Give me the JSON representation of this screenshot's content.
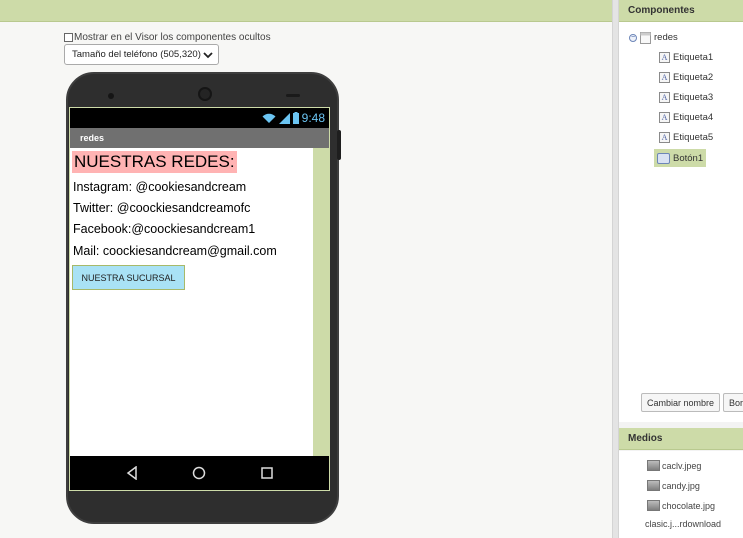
{
  "viewer": {
    "show_hidden_label": "Mostrar en el Visor los componentes ocultos",
    "size_select_value": "Tamaño del teléfono (505,320)"
  },
  "phone": {
    "status_time": "9:48",
    "screen_title": "redes",
    "heading": "NUESTRAS REDES:",
    "lines": [
      "Instagram: @cookiesandcream",
      "Twitter: @coockiesandcreamofc",
      "Facebook:@coockiesandcream1",
      "Mail: coockiesandcream@gmail.com"
    ],
    "button_label": "NUESTRA SUCURSAL"
  },
  "components": {
    "title": "Componentes",
    "root": "redes",
    "items": [
      "Etiqueta1",
      "Etiqueta2",
      "Etiqueta3",
      "Etiqueta4",
      "Etiqueta5",
      "Botón1"
    ],
    "rename_button": "Cambiar nombre",
    "delete_button": "Borrar"
  },
  "media": {
    "title": "Medios",
    "files": [
      "caclv.jpeg",
      "candy.jpg",
      "chocolate.jpg",
      "clasic.j...rdownload"
    ]
  },
  "colors": {
    "panel_green": "#cddba8",
    "heading_bg": "#ffb3b3",
    "button_bg": "#a9e2f5"
  }
}
